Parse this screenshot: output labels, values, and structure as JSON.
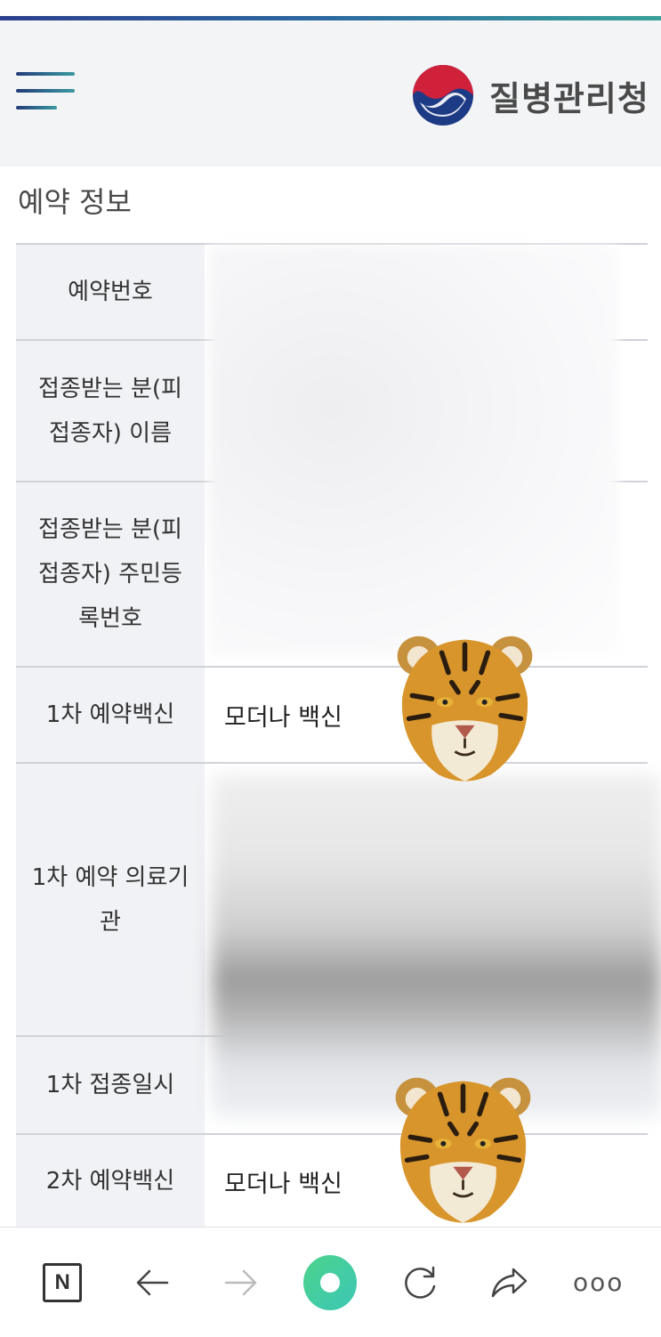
{
  "header": {
    "logo_text": "질병관리청",
    "colors": {
      "accent_start": "#2b3f8c",
      "accent_end": "#3aa19a",
      "logo_red": "#d0213b",
      "logo_blue": "#1d3b85"
    }
  },
  "section": {
    "title": "예약 정보"
  },
  "table": {
    "rows": [
      {
        "label": "예약번호",
        "value": ""
      },
      {
        "label": "접종받는 분(피 접종자) 이름",
        "value": ""
      },
      {
        "label": "접종받는 분(피 접종자) 주민등록번호",
        "value": ""
      },
      {
        "label": "1차 예약백신",
        "value": "모더나 백신"
      },
      {
        "label": "1차 예약 의료기관",
        "value": ""
      },
      {
        "label": "1차 접종일시",
        "value": ""
      },
      {
        "label": "2차 예약백신",
        "value": "모더나 백신"
      }
    ]
  },
  "bottom_nav": {
    "n_label": "N",
    "more": "ooo"
  },
  "icons": [
    "menu-icon",
    "government-logo-icon",
    "tiger-sticker-icon",
    "back-arrow-icon",
    "forward-arrow-icon",
    "home-circle-icon",
    "reload-icon",
    "share-icon",
    "more-icon"
  ]
}
